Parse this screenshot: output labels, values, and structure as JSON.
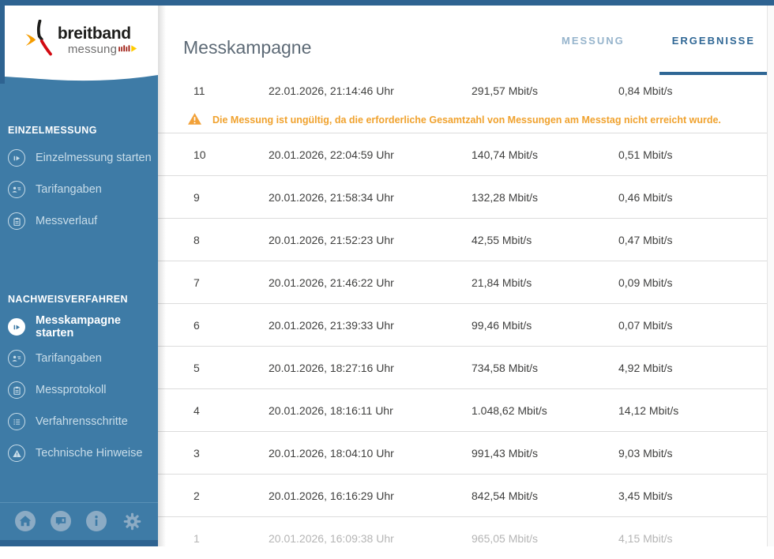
{
  "app": {
    "logo_line1": "breitband",
    "logo_line2": "messung"
  },
  "header": {
    "title": "Messkampagne",
    "tabs": [
      {
        "label": "MESSUNG",
        "active": false
      },
      {
        "label": "ERGEBNISSE",
        "active": true
      }
    ]
  },
  "sidebar": {
    "sections": [
      {
        "title": "EINZELMESSUNG",
        "items": [
          {
            "label": "Einzelmessung starten",
            "icon": "play-circle-icon",
            "active": false
          },
          {
            "label": "Tarifangaben",
            "icon": "tariff-icon",
            "active": false
          },
          {
            "label": "Messverlauf",
            "icon": "clipboard-icon",
            "active": false
          }
        ]
      },
      {
        "title": "NACHWEISVERFAHREN",
        "items": [
          {
            "label": "Messkampagne starten",
            "icon": "play-circle-icon",
            "active": true
          },
          {
            "label": "Tarifangaben",
            "icon": "tariff-icon",
            "active": false
          },
          {
            "label": "Messprotokoll",
            "icon": "clipboard-icon",
            "active": false
          },
          {
            "label": "Verfahrensschritte",
            "icon": "list-icon",
            "active": false
          },
          {
            "label": "Technische Hinweise",
            "icon": "warning-triangle-icon",
            "active": false
          }
        ]
      }
    ],
    "footer_icons": [
      "home-icon",
      "feedback-icon",
      "info-icon",
      "settings-icon"
    ]
  },
  "results": {
    "warning_text": "Die Messung ist ungültig, da die erforderliche Gesamtzahl von Messungen am Messtag nicht erreicht wurde.",
    "rows": [
      {
        "num": "11",
        "date": "22.01.2026, 21:14:46 Uhr",
        "download": "291,57 Mbit/s",
        "upload": "0,84 Mbit/s",
        "warning": true,
        "muted": false
      },
      {
        "num": "10",
        "date": "20.01.2026, 22:04:59 Uhr",
        "download": "140,74 Mbit/s",
        "upload": "0,51 Mbit/s",
        "warning": false,
        "muted": false
      },
      {
        "num": "9",
        "date": "20.01.2026, 21:58:34 Uhr",
        "download": "132,28 Mbit/s",
        "upload": "0,46 Mbit/s",
        "warning": false,
        "muted": false
      },
      {
        "num": "8",
        "date": "20.01.2026, 21:52:23 Uhr",
        "download": "42,55 Mbit/s",
        "upload": "0,47 Mbit/s",
        "warning": false,
        "muted": false
      },
      {
        "num": "7",
        "date": "20.01.2026, 21:46:22 Uhr",
        "download": "21,84 Mbit/s",
        "upload": "0,09 Mbit/s",
        "warning": false,
        "muted": false
      },
      {
        "num": "6",
        "date": "20.01.2026, 21:39:33 Uhr",
        "download": "99,46 Mbit/s",
        "upload": "0,07 Mbit/s",
        "warning": false,
        "muted": false
      },
      {
        "num": "5",
        "date": "20.01.2026, 18:27:16 Uhr",
        "download": "734,58 Mbit/s",
        "upload": "4,92 Mbit/s",
        "warning": false,
        "muted": false
      },
      {
        "num": "4",
        "date": "20.01.2026, 18:16:11 Uhr",
        "download": "1.048,62 Mbit/s",
        "upload": "14,12 Mbit/s",
        "warning": false,
        "muted": false
      },
      {
        "num": "3",
        "date": "20.01.2026, 18:04:10 Uhr",
        "download": "991,43 Mbit/s",
        "upload": "9,03 Mbit/s",
        "warning": false,
        "muted": false
      },
      {
        "num": "2",
        "date": "20.01.2026, 16:16:29 Uhr",
        "download": "842,54 Mbit/s",
        "upload": "3,45 Mbit/s",
        "warning": false,
        "muted": false
      },
      {
        "num": "1",
        "date": "20.01.2026, 16:09:38 Uhr",
        "download": "965,05 Mbit/s",
        "upload": "4,15 Mbit/s",
        "warning": false,
        "muted": true
      }
    ]
  },
  "colors": {
    "frame": "#2e6391",
    "sidebar": "#3e7ba6",
    "tab_active": "#2f6795",
    "warning": "#f0a22e",
    "logo_red": "#d20a11",
    "logo_yellow": "#ffcc00",
    "separator": "#dcdcdc"
  }
}
